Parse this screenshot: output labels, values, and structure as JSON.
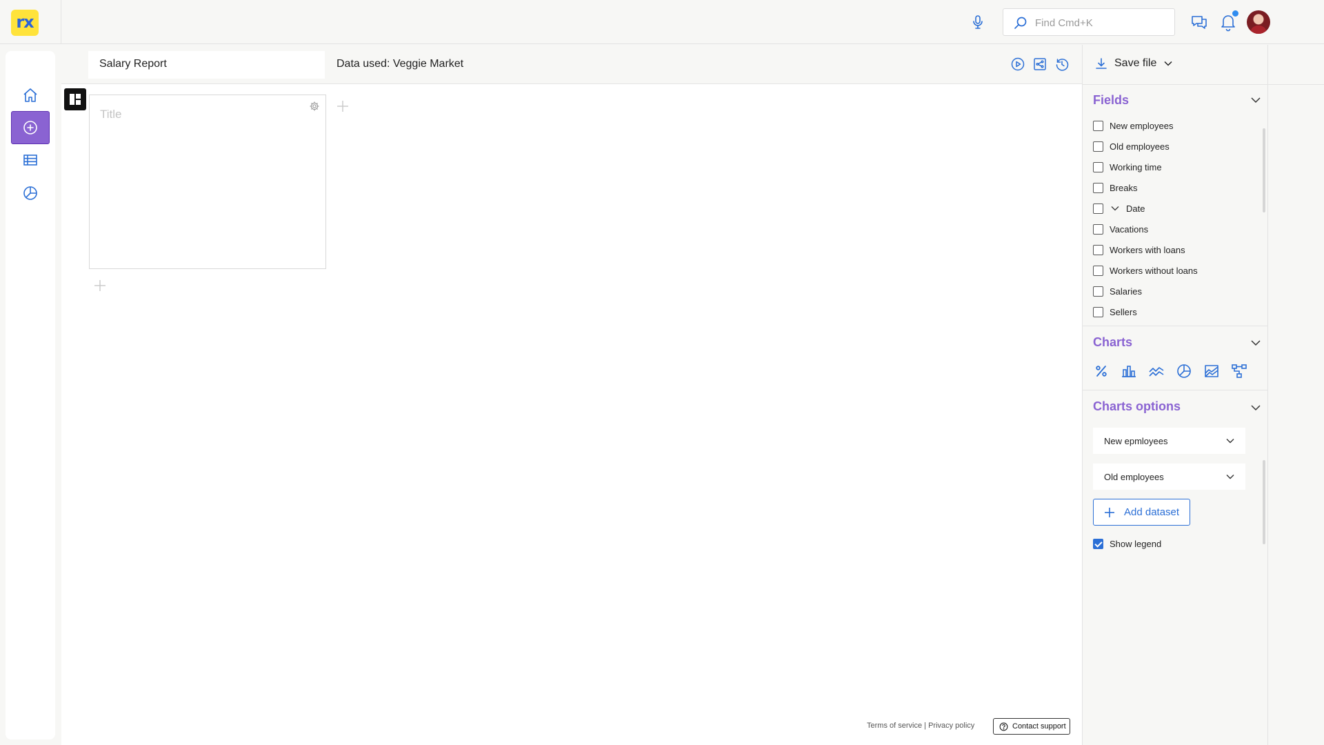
{
  "app": {
    "logo_text": "rx"
  },
  "topbar": {
    "search_placeholder": "Find Cmd+K",
    "accent_color": "#2f8cf0"
  },
  "sidebar": {
    "items": [
      {
        "name": "home",
        "icon": "home-icon",
        "active": false
      },
      {
        "name": "create",
        "icon": "plus-circle-icon",
        "active": true
      },
      {
        "name": "data",
        "icon": "table-list-icon",
        "active": false
      },
      {
        "name": "reports",
        "icon": "pie-chart-icon",
        "active": false
      }
    ],
    "active_color": "#8a63d2"
  },
  "editor": {
    "report_title": "Salary Report",
    "data_used": "Data used: Veggie Market",
    "header_icons": [
      "play-icon",
      "share-icon",
      "history-icon"
    ]
  },
  "canvas": {
    "widget": {
      "title_placeholder": "Title"
    }
  },
  "footer": {
    "terms": "Terms of service",
    "separator": "|",
    "privacy": "Privacy policy",
    "contact": "Contact support"
  },
  "panel": {
    "save_label": "Save file",
    "fields": {
      "title": "Fields",
      "items": [
        {
          "label": "New employees",
          "checked": false
        },
        {
          "label": "Old employees",
          "checked": false
        },
        {
          "label": "Working time",
          "checked": false
        },
        {
          "label": "Breaks",
          "checked": false
        },
        {
          "label": "Date",
          "checked": false,
          "expandable": true
        },
        {
          "label": "Vacations",
          "checked": false
        },
        {
          "label": "Workers with loans",
          "checked": false
        },
        {
          "label": "Workers without loans",
          "checked": false
        },
        {
          "label": "Salaries",
          "checked": false
        },
        {
          "label": "Sellers",
          "checked": false
        }
      ]
    },
    "charts": {
      "title": "Charts",
      "icons": [
        "percent-icon",
        "bar-chart-icon",
        "line-chart-icon",
        "pie-chart-icon",
        "area-chart-icon",
        "flow-chart-icon"
      ]
    },
    "chart_options": {
      "title": "Charts options",
      "dataset_1": "New epmloyees",
      "dataset_2": "Old employees",
      "add_dataset": "Add dataset",
      "show_legend": "Show legend",
      "show_legend_checked": true
    },
    "title_color": "#8a63d2",
    "link_color": "#2b6fd6"
  }
}
